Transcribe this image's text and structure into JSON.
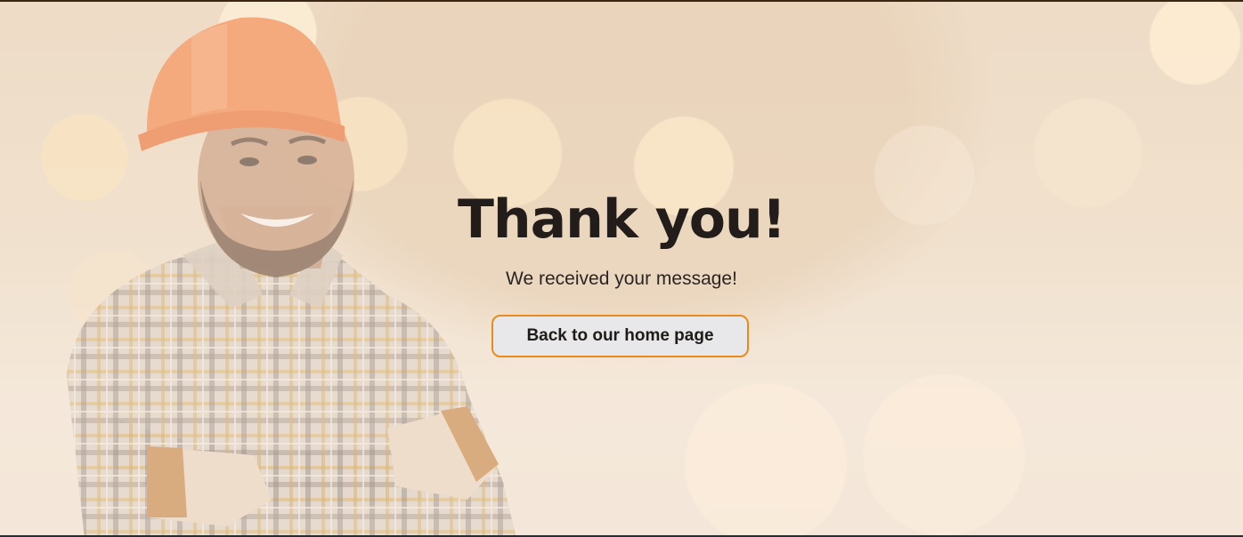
{
  "page": {
    "title": "Thank you!",
    "message": "We received your message!",
    "home_button_label": "Back to our home page"
  },
  "colors": {
    "accent_border": "#e88a1c",
    "button_fill": "#e8e8ea",
    "text_dark": "#221d1a",
    "background": "#ecdcc6"
  },
  "icons": {
    "hero_image": "worker-photo"
  }
}
